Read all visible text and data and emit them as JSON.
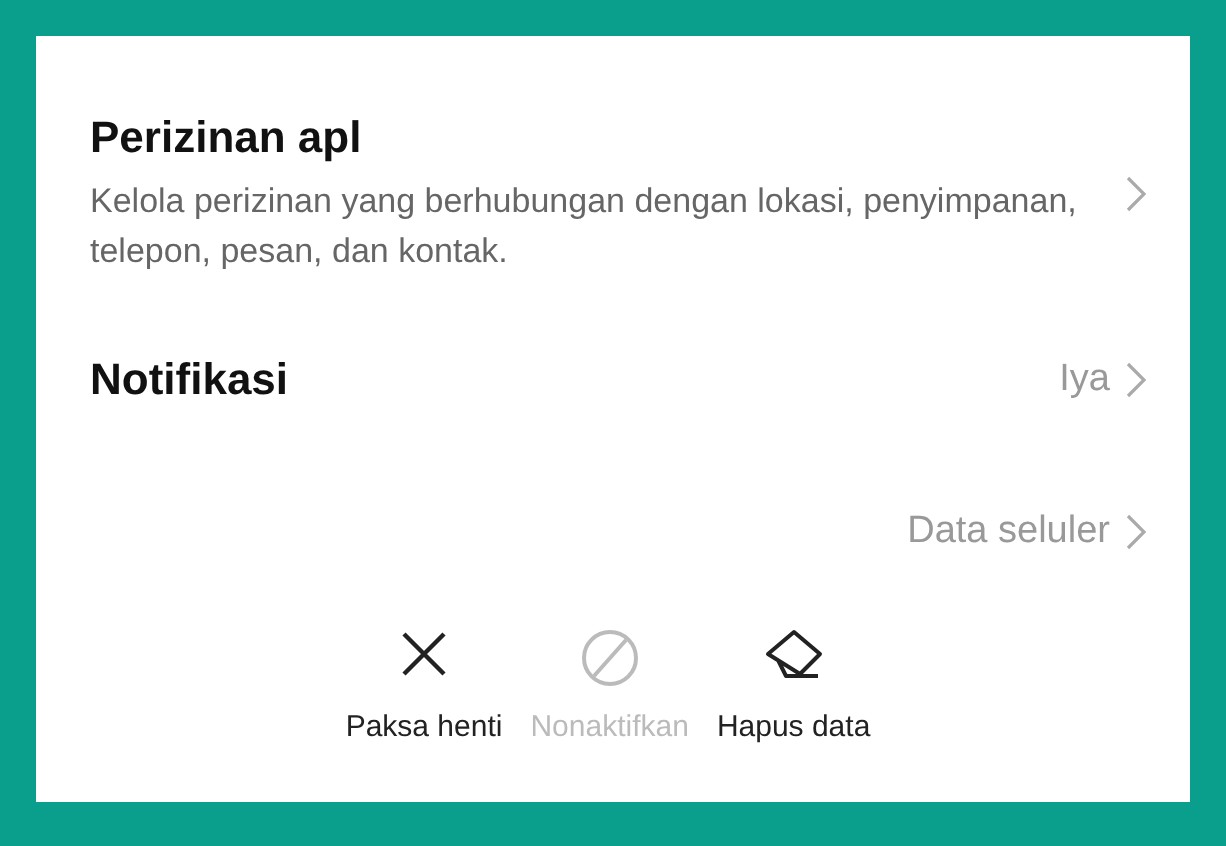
{
  "settings": [
    {
      "title": "Perizinan apl",
      "description": "Kelola perizinan yang berhubungan dengan lokasi, penyimpanan, telepon, pesan, dan kontak."
    },
    {
      "title": "Notifikasi",
      "value": "Iya"
    },
    {
      "value": "Data seluler"
    }
  ],
  "actions": [
    {
      "kind": "close",
      "label": "Paksa henti",
      "disabled": false
    },
    {
      "kind": "block",
      "label": "Nonaktifkan",
      "disabled": true
    },
    {
      "kind": "eraser",
      "label": "Hapus data",
      "disabled": false
    }
  ]
}
